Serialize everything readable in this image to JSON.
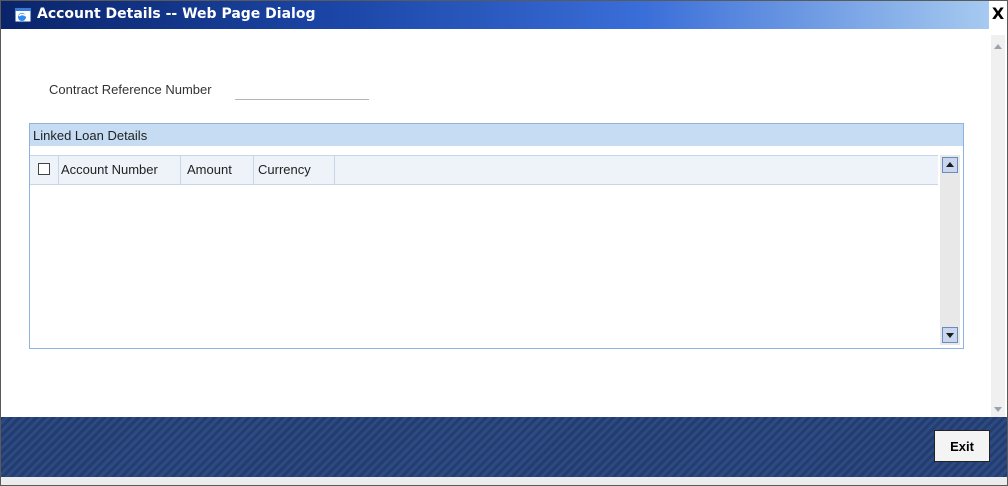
{
  "window": {
    "title": "Account Details -- Web Page Dialog",
    "close_label": "X"
  },
  "form": {
    "contract_ref_label": "Contract Reference Number",
    "contract_ref_value": ""
  },
  "linked_loan": {
    "title": "Linked Loan Details",
    "columns": [
      "Account Number",
      "Amount",
      "Currency"
    ],
    "rows": []
  },
  "footer": {
    "exit_label": "Exit"
  },
  "colors": {
    "title_bar": "#0a246a",
    "panel_header": "#c5dcf3",
    "footer": "#2c4a83"
  },
  "icons": {
    "app": "ie-dialog-icon",
    "close": "close-icon"
  }
}
